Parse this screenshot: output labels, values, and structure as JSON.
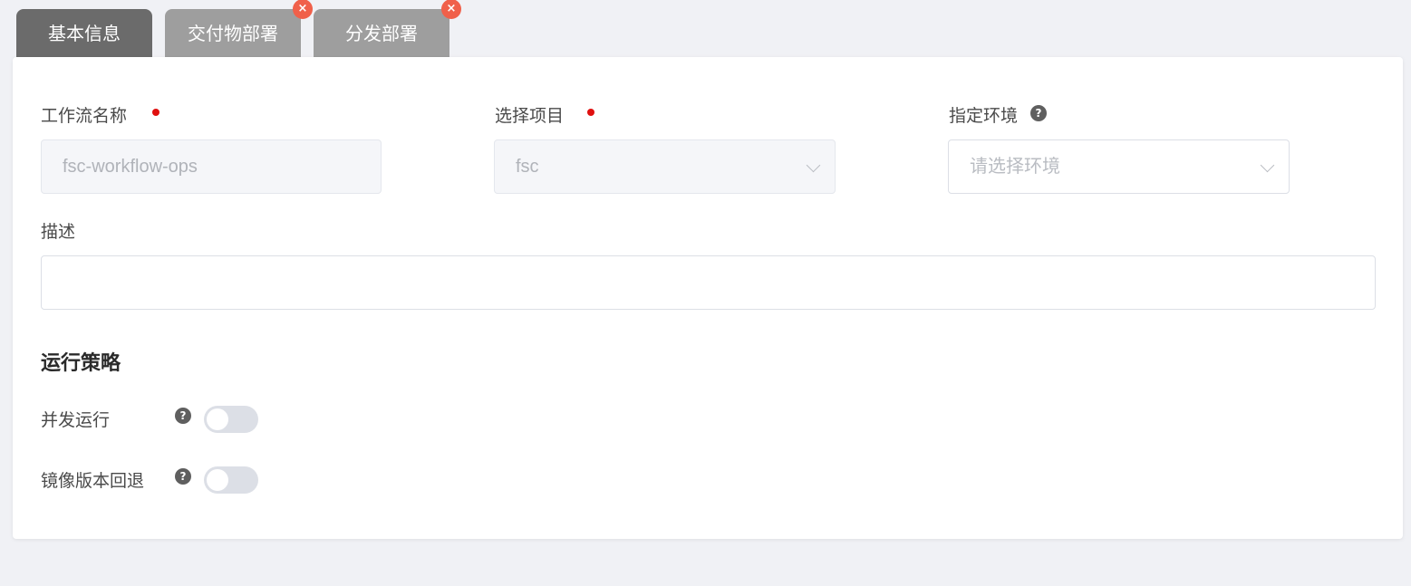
{
  "tabs": [
    {
      "label": "基本信息",
      "active": true,
      "closable": false
    },
    {
      "label": "交付物部署",
      "active": false,
      "closable": true
    },
    {
      "label": "分发部署",
      "active": false,
      "closable": true
    }
  ],
  "tab_close_glyph": "×",
  "form": {
    "workflow_name": {
      "label": "工作流名称",
      "value": "fsc-workflow-ops"
    },
    "project": {
      "label": "选择项目",
      "value": "fsc"
    },
    "environment": {
      "label": "指定环境",
      "placeholder": "请选择环境"
    },
    "description": {
      "label": "描述",
      "value": ""
    }
  },
  "strategy": {
    "title": "运行策略",
    "concurrent": {
      "label": "并发运行",
      "enabled": false
    },
    "image_rollback": {
      "label": "镜像版本回退",
      "enabled": false
    }
  },
  "help_glyph": "?",
  "colors": {
    "active_tab": "#6b6b6b",
    "inactive_tab": "#9e9e9e",
    "close_badge": "#f0604a",
    "required_dot": "#e0100f"
  },
  "icons": {
    "close": "close-icon",
    "help": "question-circle-icon",
    "dropdown": "chevron-down-icon"
  }
}
